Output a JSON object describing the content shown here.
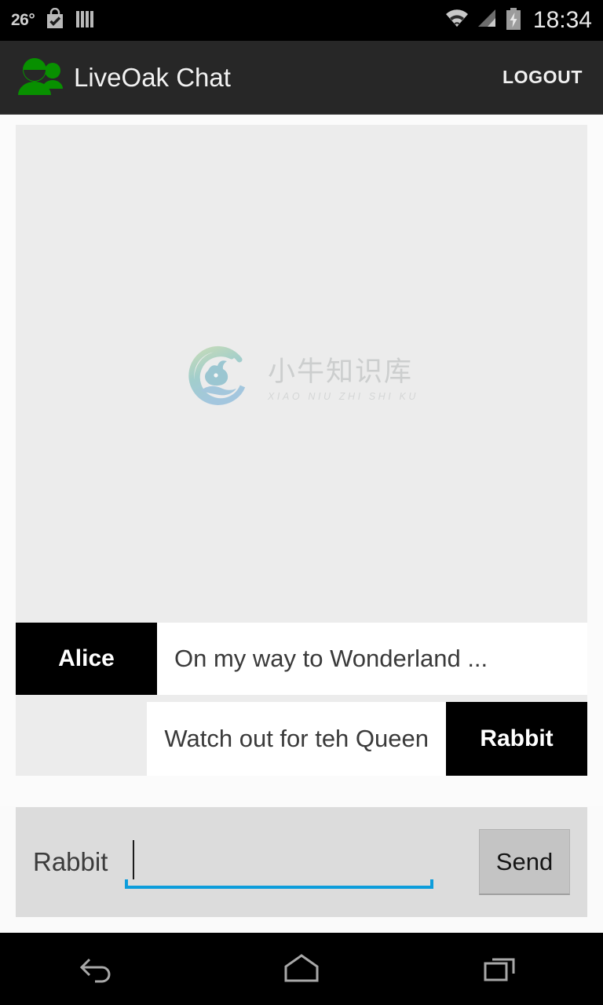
{
  "status_bar": {
    "temperature": "26°",
    "clock": "18:34",
    "icons": [
      "play-store-bag-icon",
      "bars-icon",
      "wifi-icon",
      "cell-signal-icon",
      "battery-charging-icon"
    ]
  },
  "app_bar": {
    "logo_icon": "people-group-icon",
    "title": "LiveOak Chat",
    "logout_label": "LOGOUT",
    "background_color": "#272727",
    "logo_color": "#089000"
  },
  "watermark": {
    "chinese_text": "小牛知识库",
    "pinyin_text": "XIAO NIU ZHI SHI KU",
    "logo_icon": "ox-circle-logo-icon"
  },
  "messages": [
    {
      "author": "Alice",
      "text": "On my way to Wonderland ...",
      "direction": "incoming"
    },
    {
      "author": "Rabbit",
      "text": "Watch out for teh Queen",
      "direction": "outgoing"
    }
  ],
  "input_bar": {
    "username": "Rabbit",
    "input_value": "",
    "input_placeholder": "",
    "send_label": "Send",
    "underline_color": "#0d9ddb"
  },
  "nav_bar": {
    "back_icon": "back-arrow-icon",
    "home_icon": "home-icon",
    "recents_icon": "recents-icon"
  }
}
